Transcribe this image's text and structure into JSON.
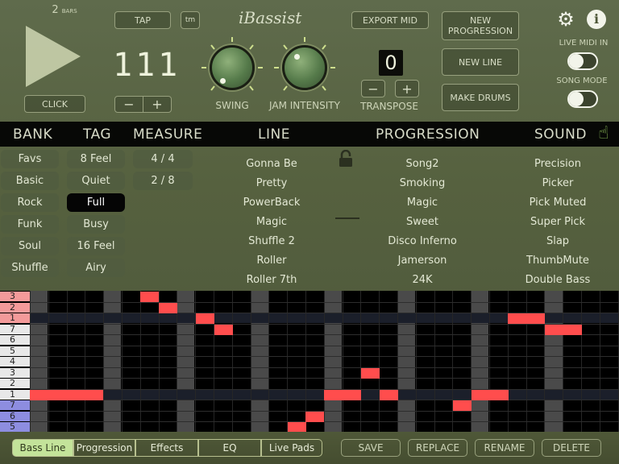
{
  "app": {
    "logo_text": "iBassist"
  },
  "transport": {
    "beats": "2",
    "beats_unit": "BARS",
    "click_label": "CLICK",
    "tap_label": "TAP",
    "tm_label": "tm",
    "tempo": "111",
    "minus": "−",
    "plus": "+"
  },
  "knobs": {
    "swing_label": "SWING",
    "jam_label": "JAM INTENSITY"
  },
  "export_label": "EXPORT MID",
  "transpose": {
    "value": "0",
    "label": "TRANSPOSE",
    "minus": "−",
    "plus": "+"
  },
  "actions": {
    "new_progression": "NEW PROGRESSION",
    "new_line": "NEW LINE",
    "make_drums": "MAKE DRUMS"
  },
  "toggles": {
    "live_midi_label": "LIVE MIDI IN",
    "song_mode_label": "SONG MODE",
    "live_midi_on": false,
    "song_mode_on": false
  },
  "columns": {
    "bank": "BANK",
    "tag": "TAG",
    "measure": "MEASURE",
    "line": "LINE",
    "progression": "PROGRESSION",
    "sound": "SOUND"
  },
  "bank": [
    "Favs",
    "Basic",
    "Rock",
    "Funk",
    "Soul",
    "Shuffle"
  ],
  "tag": [
    "8 Feel",
    "Quiet",
    "Full",
    "Busy",
    "16 Feel",
    "Airy"
  ],
  "tag_selected": "Full",
  "measure": [
    "4 / 4",
    "2 / 8"
  ],
  "line": [
    "Gonna Be",
    "Pretty",
    "PowerBack",
    "Magic",
    "Shuffle 2",
    "Roller",
    "Roller 7th"
  ],
  "progression": [
    "Song2",
    "Smoking",
    "Magic",
    "Sweet",
    "Disco Inferno",
    "Jamerson",
    "24K"
  ],
  "sound": [
    "Precision",
    "Picker",
    "Pick Muted",
    "Super Pick",
    "Slap",
    "ThumbMute",
    "Double Bass"
  ],
  "roll": {
    "keys": [
      {
        "label": "3",
        "color": "#f39a9a"
      },
      {
        "label": "2",
        "color": "#f39a9a"
      },
      {
        "label": "1",
        "color": "#f39a9a"
      },
      {
        "label": "7",
        "color": "#e8e8e8"
      },
      {
        "label": "6",
        "color": "#e8e8e8"
      },
      {
        "label": "5",
        "color": "#e8e8e8"
      },
      {
        "label": "4",
        "color": "#e8e8e8"
      },
      {
        "label": "3",
        "color": "#e8e8e8"
      },
      {
        "label": "2",
        "color": "#e8e8e8"
      },
      {
        "label": "1",
        "color": "#e8e8e8"
      },
      {
        "label": "7",
        "color": "#8d8de0"
      },
      {
        "label": "6",
        "color": "#8d8de0"
      },
      {
        "label": "5",
        "color": "#8d8de0"
      }
    ]
  },
  "tabs": [
    "Bass Line",
    "Progression",
    "Effects",
    "EQ",
    "Live Pads"
  ],
  "tab_selected": "Bass Line",
  "bottom_actions": [
    "SAVE",
    "REPLACE",
    "RENAME",
    "DELETE"
  ],
  "colors": {
    "accent": "#c3e39a",
    "note": "#ff4d4d"
  }
}
